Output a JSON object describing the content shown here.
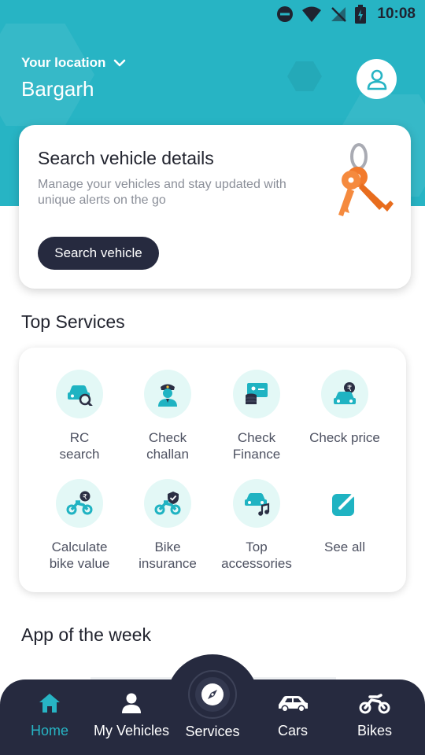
{
  "status_bar": {
    "time": "10:08"
  },
  "header": {
    "location_label": "Your location",
    "city": "Bargarh"
  },
  "search_card": {
    "title": "Search vehicle details",
    "description": "Manage your vehicles and stay updated with unique alerts on the go",
    "button_label": "Search vehicle"
  },
  "top_services": {
    "title": "Top Services",
    "items": [
      {
        "label_line1": "RC",
        "label_line2": "search",
        "icon": "car-search-icon"
      },
      {
        "label_line1": "Check",
        "label_line2": "challan",
        "icon": "traffic-police-icon"
      },
      {
        "label_line1": "Check",
        "label_line2": "Finance",
        "icon": "finance-icon"
      },
      {
        "label_line1": "Check price",
        "label_line2": "",
        "icon": "car-rupee-icon"
      },
      {
        "label_line1": "Calculate",
        "label_line2": "bike value",
        "icon": "bike-rupee-icon"
      },
      {
        "label_line1": "Bike",
        "label_line2": "insurance",
        "icon": "bike-shield-icon"
      },
      {
        "label_line1": "Top",
        "label_line2": "accessories",
        "icon": "car-music-icon"
      },
      {
        "label_line1": "See all",
        "label_line2": "",
        "icon": "external-link-icon"
      }
    ]
  },
  "app_of_week": {
    "title": "App of the week"
  },
  "bottom_nav": {
    "items": [
      {
        "label": "Home",
        "icon": "home-icon",
        "active": true
      },
      {
        "label": "My Vehicles",
        "icon": "user-icon"
      },
      {
        "label": "Services",
        "icon": "compass-icon"
      },
      {
        "label": "Cars",
        "icon": "car-icon"
      },
      {
        "label": "Bikes",
        "icon": "bike-icon"
      }
    ]
  },
  "colors": {
    "accent": "#27b4c4",
    "dark": "#262a3f",
    "icon_bg": "#e3f8f6",
    "key": "#f27a2c"
  }
}
